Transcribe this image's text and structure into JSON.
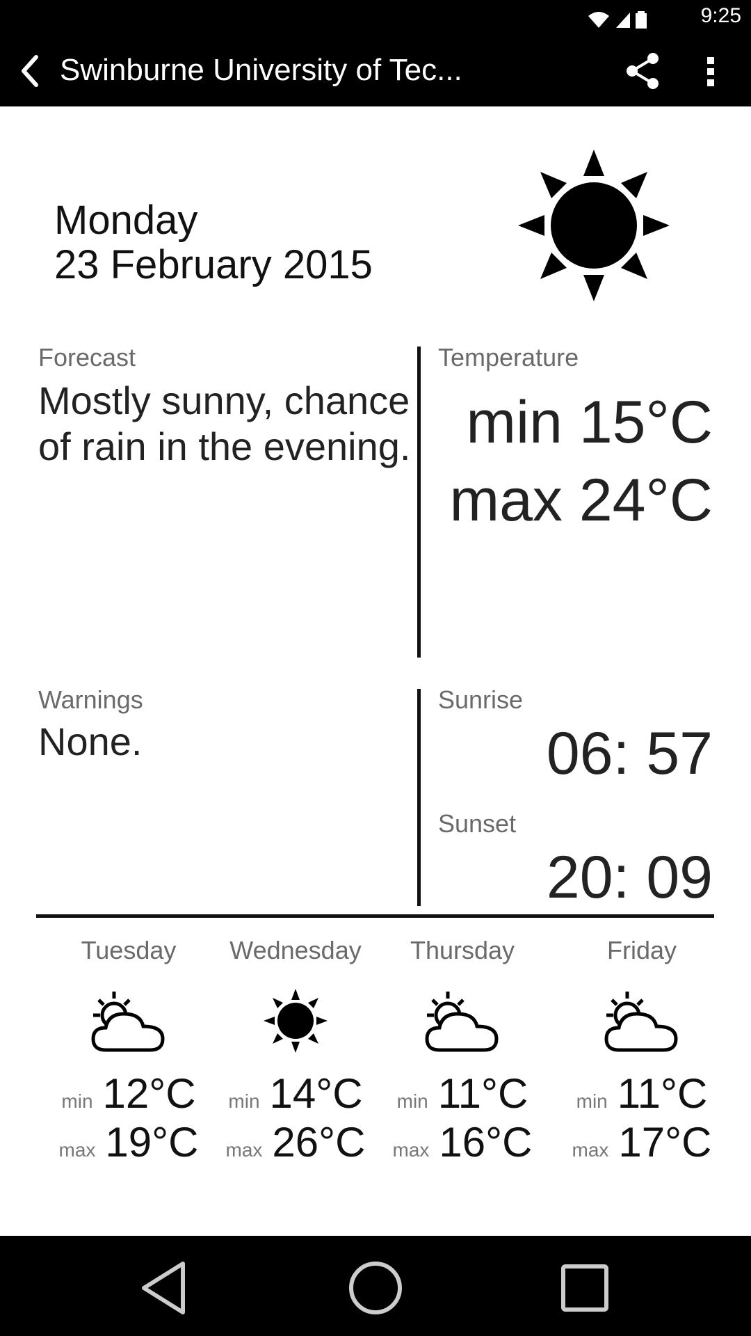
{
  "status": {
    "time": "9:25"
  },
  "appbar": {
    "title": "Swinburne University of Tec..."
  },
  "date": {
    "weekday": "Monday",
    "full": "23 February 2015"
  },
  "forecast": {
    "label": "Forecast",
    "text": "Mostly sunny, chance of rain in the evening."
  },
  "temperature": {
    "label": "Temperature",
    "min": "min 15°C",
    "max": "max 24°C"
  },
  "warnings": {
    "label": "Warnings",
    "text": "None."
  },
  "sunrise": {
    "label": "Sunrise",
    "time": "06: 57"
  },
  "sunset": {
    "label": "Sunset",
    "time": "20: 09"
  },
  "days": [
    {
      "name": "Tuesday",
      "icon": "partly-cloudy-icon",
      "min_label": "min",
      "min": "12°C",
      "max_label": "max",
      "max": "19°C"
    },
    {
      "name": "Wednesday",
      "icon": "sun-icon",
      "min_label": "min",
      "min": "14°C",
      "max_label": "max",
      "max": "26°C"
    },
    {
      "name": "Thursday",
      "icon": "partly-cloudy-icon",
      "min_label": "min",
      "min": "11°C",
      "max_label": "max",
      "max": "16°C"
    },
    {
      "name": "Friday",
      "icon": "partly-cloudy-icon",
      "min_label": "min",
      "min": "11°C",
      "max_label": "max",
      "max": "17°C"
    }
  ]
}
